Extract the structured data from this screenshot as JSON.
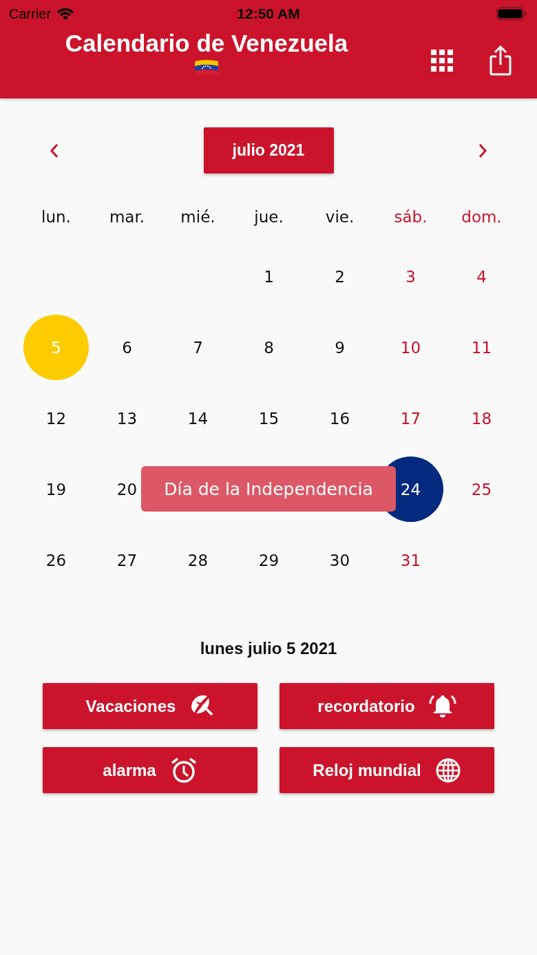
{
  "status_bar": {
    "carrier": "Carrier",
    "time": "12:50 AM"
  },
  "header": {
    "title": "Calendario de Venezuela"
  },
  "month_nav": {
    "label": "julio 2021"
  },
  "weekdays": [
    {
      "label": "lun.",
      "weekend": false
    },
    {
      "label": "mar.",
      "weekend": false
    },
    {
      "label": "mié.",
      "weekend": false
    },
    {
      "label": "jue.",
      "weekend": false
    },
    {
      "label": "vie.",
      "weekend": false
    },
    {
      "label": "sáb.",
      "weekend": true
    },
    {
      "label": "dom.",
      "weekend": true
    }
  ],
  "weeks": [
    [
      {
        "kind": "empty"
      },
      {
        "kind": "empty"
      },
      {
        "kind": "empty"
      },
      {
        "day": "1",
        "kind": "normal"
      },
      {
        "day": "2",
        "kind": "normal"
      },
      {
        "day": "3",
        "kind": "normal"
      },
      {
        "day": "4",
        "kind": "normal"
      }
    ],
    [
      {
        "day": "5",
        "kind": "selected"
      },
      {
        "day": "6",
        "kind": "normal"
      },
      {
        "day": "7",
        "kind": "normal"
      },
      {
        "day": "8",
        "kind": "normal"
      },
      {
        "day": "9",
        "kind": "normal"
      },
      {
        "day": "10",
        "kind": "normal"
      },
      {
        "day": "11",
        "kind": "normal"
      }
    ],
    [
      {
        "day": "12",
        "kind": "normal"
      },
      {
        "day": "13",
        "kind": "normal"
      },
      {
        "day": "14",
        "kind": "normal"
      },
      {
        "day": "15",
        "kind": "normal"
      },
      {
        "day": "16",
        "kind": "normal"
      },
      {
        "day": "17",
        "kind": "normal"
      },
      {
        "day": "18",
        "kind": "normal"
      }
    ],
    [
      {
        "day": "19",
        "kind": "normal"
      },
      {
        "day": "20",
        "kind": "normal"
      },
      {
        "kind": "empty"
      },
      {
        "kind": "empty"
      },
      {
        "kind": "empty"
      },
      {
        "day": "24",
        "kind": "holiday"
      },
      {
        "day": "25",
        "kind": "normal"
      }
    ],
    [
      {
        "day": "26",
        "kind": "normal"
      },
      {
        "day": "27",
        "kind": "normal"
      },
      {
        "day": "28",
        "kind": "normal"
      },
      {
        "day": "29",
        "kind": "normal"
      },
      {
        "day": "30",
        "kind": "normal"
      },
      {
        "day": "31",
        "kind": "normal"
      }
    ]
  ],
  "tooltip": {
    "text": "Día de la Independencia"
  },
  "selected_date": "lunes julio 5 2021",
  "buttons": [
    {
      "label": "Vacaciones",
      "kind": "umbrella"
    },
    {
      "label": "recordatorio",
      "kind": "bell"
    },
    {
      "label": "alarma",
      "kind": "alarm"
    },
    {
      "label": "Reloj mundial",
      "kind": "globe"
    }
  ]
}
